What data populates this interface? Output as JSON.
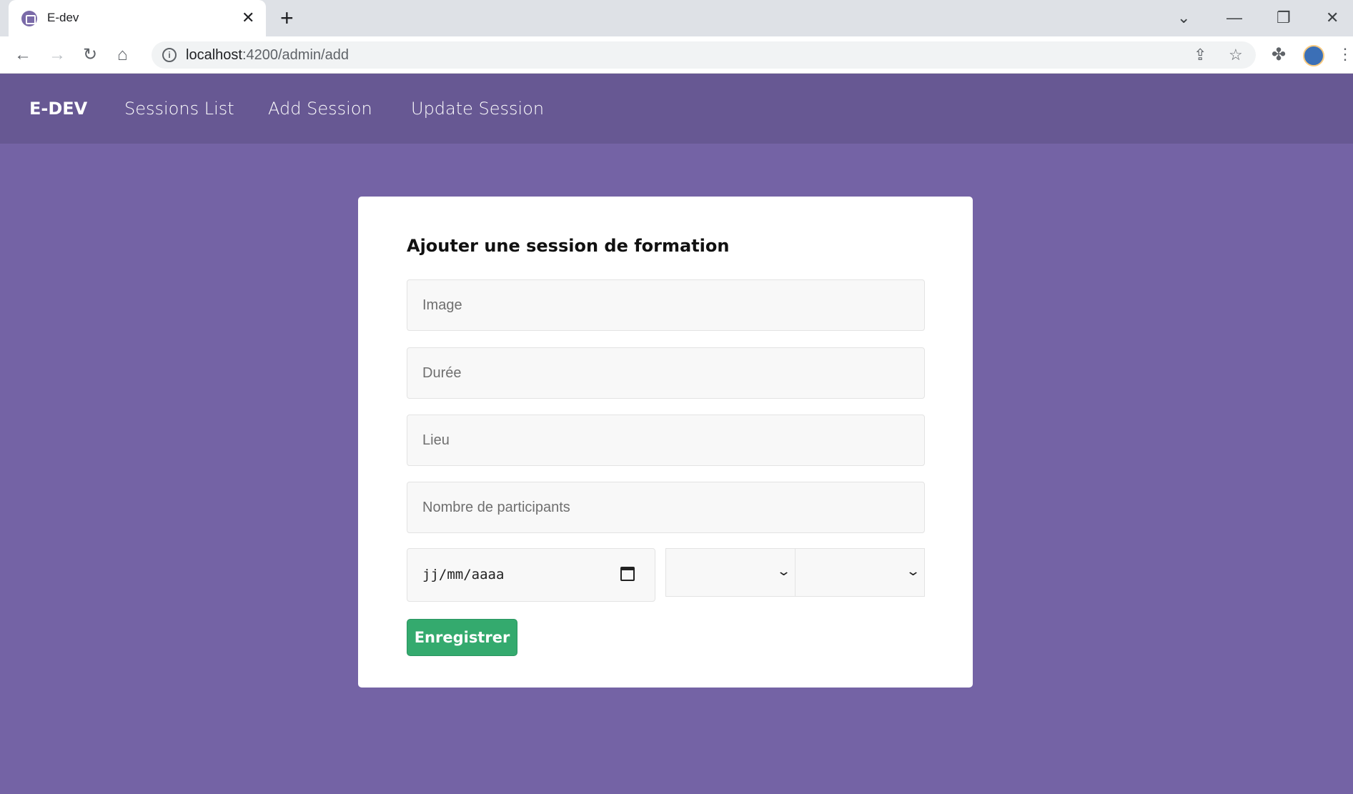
{
  "browser": {
    "tab_title": "E-dev",
    "url_host": "localhost",
    "url_path": ":4200/admin/add"
  },
  "navbar": {
    "brand": "E-DEV",
    "links": [
      "Sessions List",
      "Add Session",
      "Update Session"
    ]
  },
  "form": {
    "title": "Ajouter une session de formation",
    "fields": [
      {
        "placeholder": "Image",
        "value": ""
      },
      {
        "placeholder": "Durée",
        "value": ""
      },
      {
        "placeholder": "Lieu",
        "value": ""
      },
      {
        "placeholder": "Nombre de participants",
        "value": ""
      }
    ],
    "date_placeholder": "jj/mm/aaaa",
    "select_1_value": "",
    "select_2_value": "",
    "submit_label": "Enregistrer"
  },
  "colors": {
    "page_bg": "#7463a5",
    "navbar_bg": "#675893",
    "submit_bg": "#34aa6e"
  }
}
